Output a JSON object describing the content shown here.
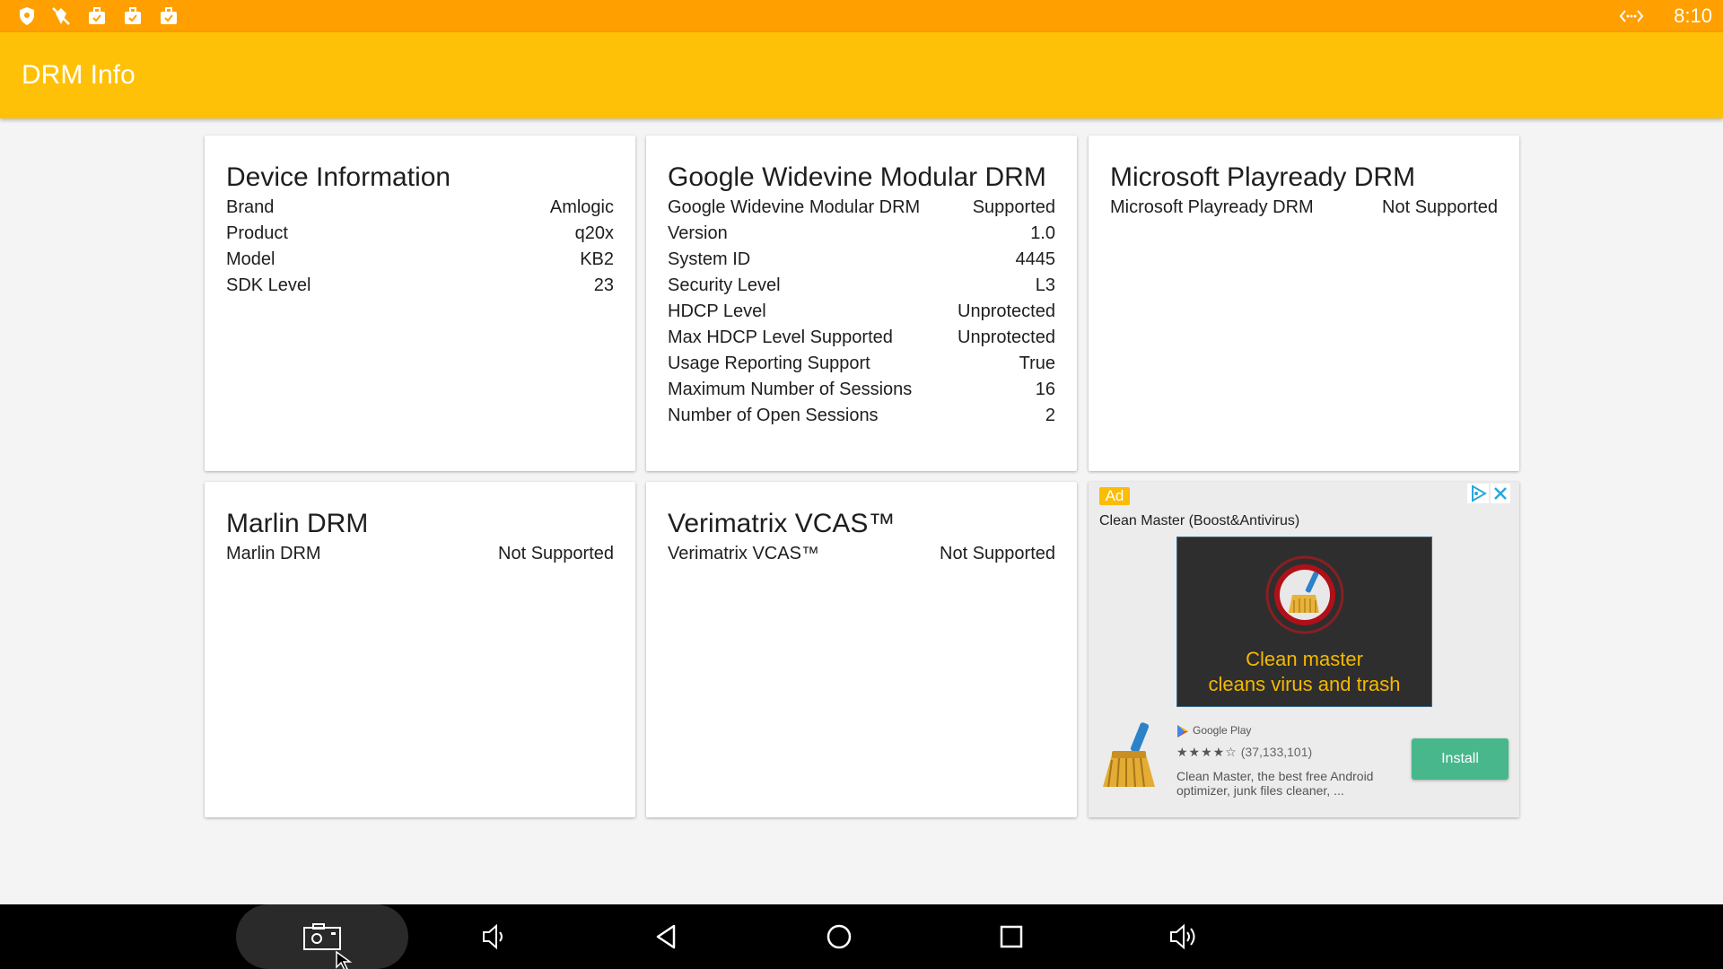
{
  "status_bar": {
    "time": "8:10",
    "icons": [
      "shield-icon",
      "no-location-icon",
      "briefcase-check-icon",
      "briefcase-check-icon",
      "briefcase-check-icon"
    ],
    "network_icon": "ethernet-icon"
  },
  "app_bar": {
    "title": "DRM Info",
    "color": "#ffc107",
    "status_color": "#ff9f00"
  },
  "cards": {
    "device": {
      "title": "Device Information",
      "rows": [
        {
          "label": "Brand",
          "value": "Amlogic"
        },
        {
          "label": "Product",
          "value": "q20x"
        },
        {
          "label": "Model",
          "value": "KB2"
        },
        {
          "label": "SDK Level",
          "value": "23"
        }
      ]
    },
    "widevine": {
      "title": "Google Widevine Modular DRM",
      "rows": [
        {
          "label": "Google Widevine Modular DRM",
          "value": "Supported"
        },
        {
          "label": "Version",
          "value": "1.0"
        },
        {
          "label": "System ID",
          "value": "4445"
        },
        {
          "label": "Security Level",
          "value": "L3"
        },
        {
          "label": "HDCP Level",
          "value": "Unprotected"
        },
        {
          "label": "Max HDCP Level Supported",
          "value": "Unprotected"
        },
        {
          "label": "Usage Reporting Support",
          "value": "True"
        },
        {
          "label": "Maximum Number of Sessions",
          "value": "16"
        },
        {
          "label": "Number of Open Sessions",
          "value": "2"
        }
      ]
    },
    "playready": {
      "title": "Microsoft Playready DRM",
      "rows": [
        {
          "label": "Microsoft Playready DRM",
          "value": "Not Supported"
        }
      ]
    },
    "marlin": {
      "title": "Marlin DRM",
      "rows": [
        {
          "label": "Marlin DRM",
          "value": "Not Supported"
        }
      ]
    },
    "verimatrix": {
      "title": "Verimatrix VCAS™",
      "rows": [
        {
          "label": "Verimatrix VCAS™",
          "value": "Not Supported"
        }
      ]
    }
  },
  "ad": {
    "badge": "Ad",
    "title": "Clean Master (Boost&Antivirus)",
    "banner_line1": "Clean master",
    "banner_line2": "cleans virus and trash",
    "store": "Google Play",
    "stars": "★★★★☆",
    "rating_count": "(37,133,101)",
    "description": "Clean Master, the best free Android optimizer, junk files cleaner, ...",
    "install_label": "Install",
    "install_color": "#48b78c",
    "choices_icon": "adchoices-icon",
    "close_icon": "close-icon"
  },
  "nav_bar": {
    "buttons": [
      "screenshot-icon",
      "volume-down-icon",
      "back-icon",
      "home-icon",
      "recents-icon",
      "volume-up-icon"
    ]
  }
}
